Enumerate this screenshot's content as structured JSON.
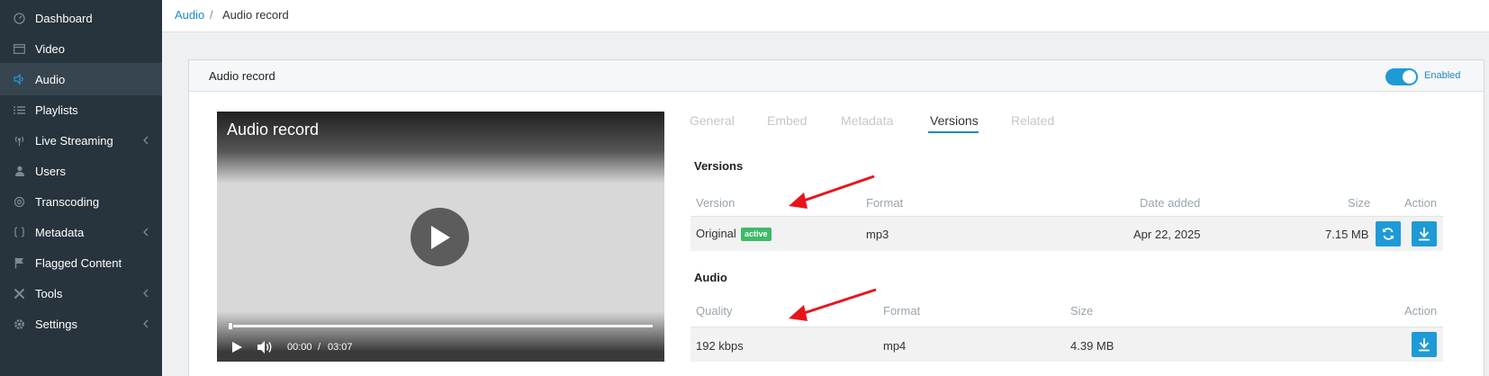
{
  "sidebar": {
    "items": [
      {
        "label": "Dashboard",
        "icon": "dashboard-icon",
        "chevron": false,
        "active": false
      },
      {
        "label": "Video",
        "icon": "video-icon",
        "chevron": false,
        "active": false
      },
      {
        "label": "Audio",
        "icon": "audio-icon",
        "chevron": false,
        "active": true
      },
      {
        "label": "Playlists",
        "icon": "playlists-icon",
        "chevron": false,
        "active": false
      },
      {
        "label": "Live Streaming",
        "icon": "live-streaming-icon",
        "chevron": true,
        "active": false
      },
      {
        "label": "Users",
        "icon": "user-icon",
        "chevron": false,
        "active": false
      },
      {
        "label": "Transcoding",
        "icon": "transcoding-icon",
        "chevron": false,
        "active": false
      },
      {
        "label": "Metadata",
        "icon": "metadata-icon",
        "chevron": true,
        "active": false
      },
      {
        "label": "Flagged Content",
        "icon": "flag-icon",
        "chevron": false,
        "active": false
      },
      {
        "label": "Tools",
        "icon": "tools-icon",
        "chevron": true,
        "active": false
      },
      {
        "label": "Settings",
        "icon": "gear-icon",
        "chevron": true,
        "active": false
      }
    ]
  },
  "breadcrumb": {
    "parent": "Audio",
    "separator": "/",
    "current": "Audio record"
  },
  "panel": {
    "title": "Audio record",
    "toggle_label": "Enabled",
    "toggle_on": true
  },
  "player": {
    "title": "Audio record",
    "current_time": "00:00",
    "time_separator": "/",
    "duration": "03:07",
    "progress": 0
  },
  "tabs": [
    {
      "label": "General",
      "active": false
    },
    {
      "label": "Embed",
      "active": false
    },
    {
      "label": "Metadata",
      "active": false
    },
    {
      "label": "Versions",
      "active": true
    },
    {
      "label": "Related",
      "active": false
    }
  ],
  "versions": {
    "title": "Versions",
    "headers": {
      "version": "Version",
      "format": "Format",
      "date_added": "Date added",
      "size": "Size",
      "action": "Action"
    },
    "rows": [
      {
        "version": "Original",
        "badge": "active",
        "format": "mp3",
        "date_added": "Apr 22, 2025",
        "size": "7.15 MB"
      }
    ]
  },
  "audio": {
    "title": "Audio",
    "headers": {
      "quality": "Quality",
      "format": "Format",
      "size": "Size",
      "action": "Action"
    },
    "rows": [
      {
        "quality": "192 kbps",
        "format": "mp4",
        "size": "4.39 MB"
      }
    ]
  },
  "colors": {
    "accent": "#1e9ad6",
    "sidebar": "#27343d",
    "badge": "#3fba6a",
    "annotation": "#e8141c"
  }
}
